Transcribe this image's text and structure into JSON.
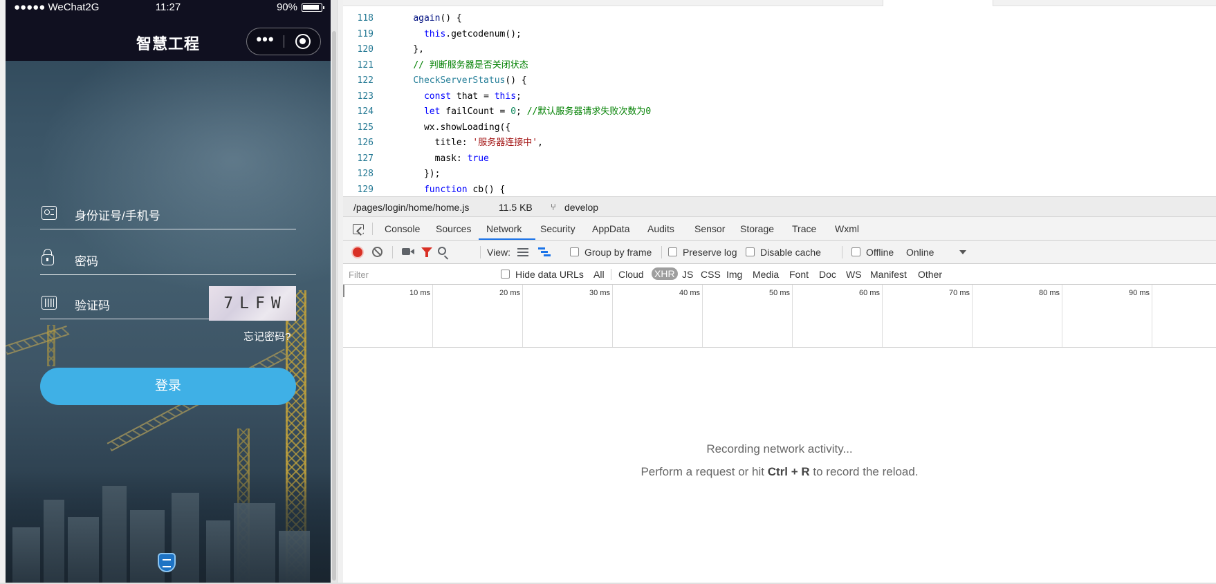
{
  "simulator": {
    "status_bar": {
      "carrier": "●●●●● WeChat2G",
      "time": "11:27",
      "battery": "90%"
    },
    "nav_title": "智慧工程",
    "capsule_more": "•••",
    "form": {
      "id_label": "身份证号/手机号",
      "password_label": "密码",
      "captcha_label": "验证码",
      "captcha_text": "7LFW",
      "forgot_link": "忘记密码?",
      "login_button": "登录"
    },
    "colors": {
      "login_button": "#3fb0e6",
      "nav_background": "#101020"
    },
    "icons": [
      "id-card-icon",
      "lock-icon",
      "barcode-icon",
      "more-dots-icon",
      "record-target-icon",
      "home-bubble-icon"
    ]
  },
  "editor": {
    "lines": [
      {
        "n": "118",
        "tokens": [
          [
            "",
            "    "
          ],
          [
            "fn",
            "again"
          ],
          [
            "",
            "() {"
          ]
        ]
      },
      {
        "n": "119",
        "tokens": [
          [
            "",
            "      "
          ],
          [
            "kw",
            "this"
          ],
          [
            "",
            ".getcodenum();"
          ]
        ]
      },
      {
        "n": "120",
        "tokens": [
          [
            "",
            "    },"
          ]
        ]
      },
      {
        "n": "121",
        "tokens": [
          [
            "",
            "    "
          ],
          [
            "cm",
            "// 判断服务器是否关闭状态"
          ]
        ]
      },
      {
        "n": "122",
        "tokens": [
          [
            "",
            "    "
          ],
          [
            "cls",
            "CheckServerStatus"
          ],
          [
            "",
            "() {"
          ]
        ]
      },
      {
        "n": "123",
        "tokens": [
          [
            "",
            "      "
          ],
          [
            "kw",
            "const"
          ],
          [
            "",
            " that = "
          ],
          [
            "kw",
            "this"
          ],
          [
            "",
            ";"
          ]
        ]
      },
      {
        "n": "124",
        "tokens": [
          [
            "",
            "      "
          ],
          [
            "kw",
            "let"
          ],
          [
            "",
            " failCount = "
          ],
          [
            "num",
            "0"
          ],
          [
            "",
            "; "
          ],
          [
            "cm",
            "//默认服务器请求失败次数为0"
          ]
        ]
      },
      {
        "n": "125",
        "tokens": [
          [
            "",
            "      wx.showLoading({"
          ]
        ]
      },
      {
        "n": "126",
        "tokens": [
          [
            "",
            "        title: "
          ],
          [
            "str",
            "'服务器连接中'"
          ],
          [
            "",
            ","
          ]
        ]
      },
      {
        "n": "127",
        "tokens": [
          [
            "",
            "        mask: "
          ],
          [
            "kw",
            "true"
          ]
        ]
      },
      {
        "n": "128",
        "tokens": [
          [
            "",
            "      });"
          ]
        ]
      },
      {
        "n": "129",
        "tokens": [
          [
            "",
            "      "
          ],
          [
            "kw",
            "function"
          ],
          [
            "",
            " cb() {"
          ]
        ]
      }
    ]
  },
  "file_info": {
    "path": "/pages/login/home/home.js",
    "size": "11.5 KB",
    "branch": "develop"
  },
  "devtools": {
    "tabs": [
      "Console",
      "Sources",
      "Network",
      "Security",
      "AppData",
      "Audits",
      "Sensor",
      "Storage",
      "Trace",
      "Wxml"
    ],
    "active_tab": "Network",
    "toolbar": {
      "view_label": "View:",
      "group_by_frame": "Group by frame",
      "preserve_log": "Preserve log",
      "disable_cache": "Disable cache",
      "offline": "Offline",
      "throttle": "Online"
    },
    "filter": {
      "placeholder": "Filter",
      "hide_data_urls": "Hide data URLs",
      "types": [
        "All",
        "Cloud",
        "XHR",
        "JS",
        "CSS",
        "Img",
        "Media",
        "Font",
        "Doc",
        "WS",
        "Manifest",
        "Other"
      ],
      "selected_type": "XHR"
    },
    "timeline_ticks": [
      "10 ms",
      "20 ms",
      "30 ms",
      "40 ms",
      "50 ms",
      "60 ms",
      "70 ms",
      "80 ms",
      "90 ms"
    ],
    "empty": {
      "line1": "Recording network activity...",
      "line2_prefix": "Perform a request or hit ",
      "line2_shortcut": "Ctrl + R",
      "line2_suffix": " to record the reload."
    },
    "colors": {
      "record": "#d93025",
      "active_underline": "#1a73e8",
      "selected_filter": "#9e9e9e"
    }
  }
}
